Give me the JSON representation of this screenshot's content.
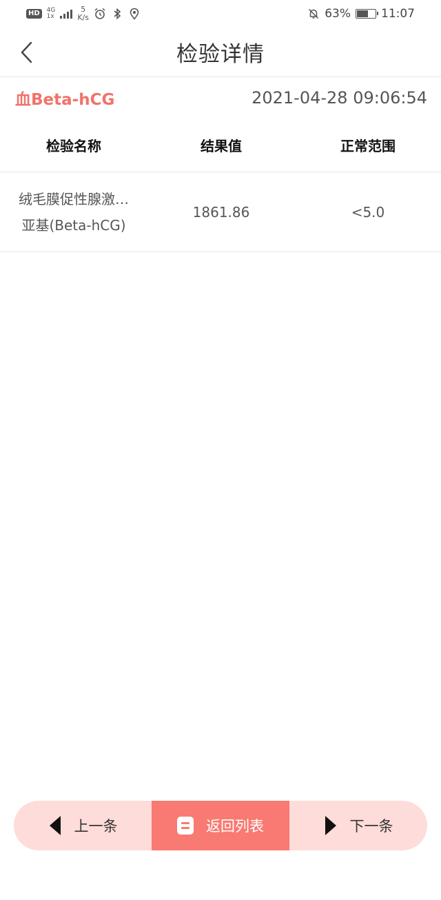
{
  "status_bar": {
    "hd": "HD",
    "network": "4G",
    "network_sub": "1x",
    "speed_value": "5",
    "speed_unit": "K/s",
    "battery_percent": "63%",
    "battery_level": 0.63,
    "time": "11:07",
    "icons": [
      "alarm-icon",
      "bluetooth-icon",
      "location-icon",
      "mute-bell-icon"
    ]
  },
  "nav": {
    "title": "检验详情",
    "back_icon": "chevron-left-icon"
  },
  "record": {
    "name": "血Beta-hCG",
    "datetime": "2021-04-28 09:06:54"
  },
  "table": {
    "headers": [
      "检验名称",
      "结果值",
      "正常范围"
    ],
    "rows": [
      {
        "name_line1": "绒毛膜促性腺激…",
        "name_line2": "亚基(Beta-hCG)",
        "result": "1861.86",
        "range": "<5.0"
      }
    ]
  },
  "bottom_bar": {
    "prev_label": "上一条",
    "back_list_label": "返回列表",
    "next_label": "下一条"
  },
  "colors": {
    "accent": "#f0736a",
    "bar_bg": "#fddcd9",
    "button_active": "#f87a72"
  }
}
